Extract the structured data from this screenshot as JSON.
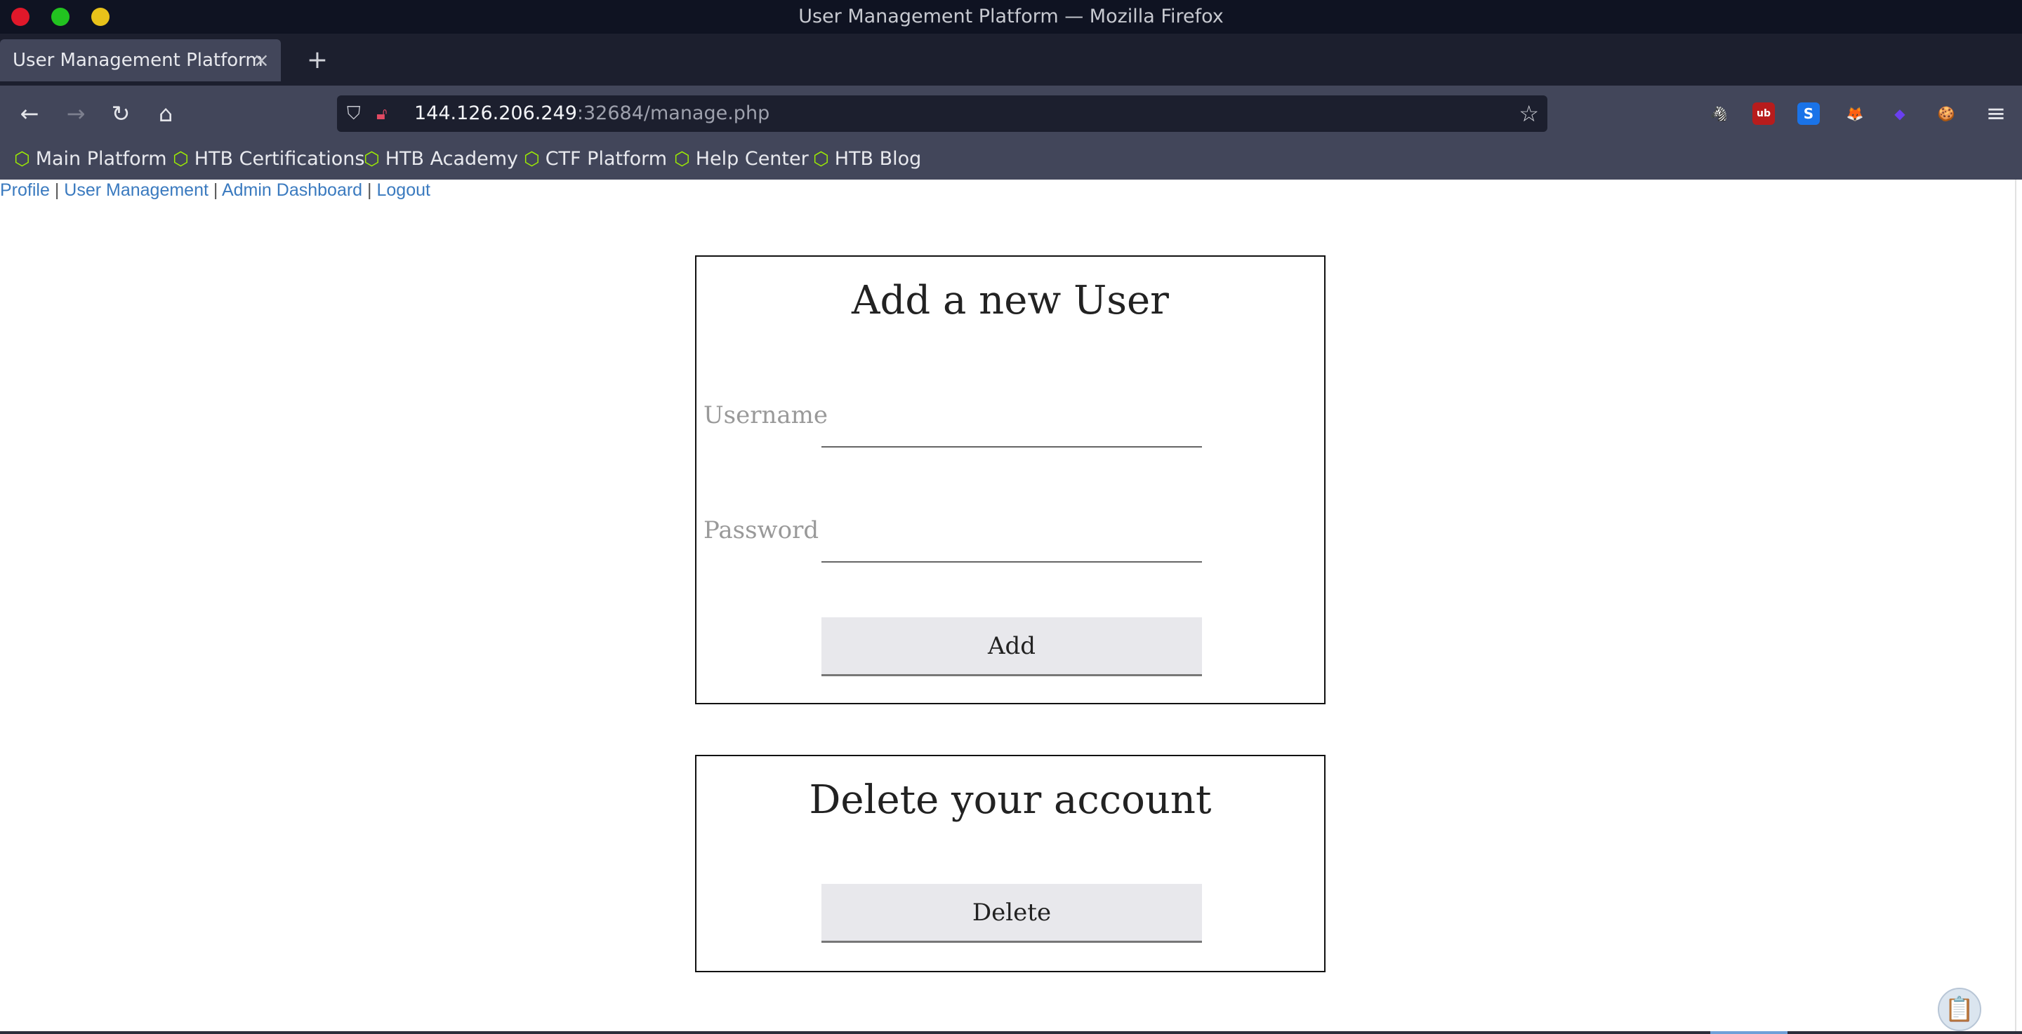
{
  "window": {
    "title": "User Management Platform — Mozilla Firefox"
  },
  "tabs": [
    {
      "label": "User Management Platform",
      "close": "×"
    }
  ],
  "new_tab": "+",
  "nav": {
    "back": "←",
    "forward": "→",
    "reload": "↻",
    "home": "⌂"
  },
  "url": {
    "host": "144.126.206.249",
    "path": ":32684/manage.php"
  },
  "extensions": [
    {
      "name": "wappalyzer-icon",
      "glyph": "🦓"
    },
    {
      "name": "ublock-icon",
      "glyph": "ub"
    },
    {
      "name": "s-extension-icon",
      "glyph": "S"
    },
    {
      "name": "foxyproxy-icon",
      "glyph": "🦊"
    },
    {
      "name": "purple-extension-icon",
      "glyph": "◆"
    },
    {
      "name": "cookie-icon",
      "glyph": "🍪"
    }
  ],
  "menu": "≡",
  "bookmarks": [
    {
      "label": "Main Platform"
    },
    {
      "label": "HTB Certifications"
    },
    {
      "label": "HTB Academy"
    },
    {
      "label": "CTF Platform"
    },
    {
      "label": "Help Center"
    },
    {
      "label": "HTB Blog"
    }
  ],
  "page": {
    "links": [
      "Profile",
      "User Management",
      "Admin Dashboard",
      "Logout"
    ],
    "separator": "|",
    "add_form": {
      "title": "Add a new User",
      "username_label": "Username",
      "username_value": "",
      "password_label": "Password",
      "password_value": "",
      "submit": "Add"
    },
    "delete_form": {
      "title": "Delete your account",
      "submit": "Delete"
    }
  },
  "colors": {
    "link": "#3a7abf",
    "bookmark_icon": "#9fef00",
    "titlebar": "#0f1322",
    "toolbar": "#42465a"
  }
}
